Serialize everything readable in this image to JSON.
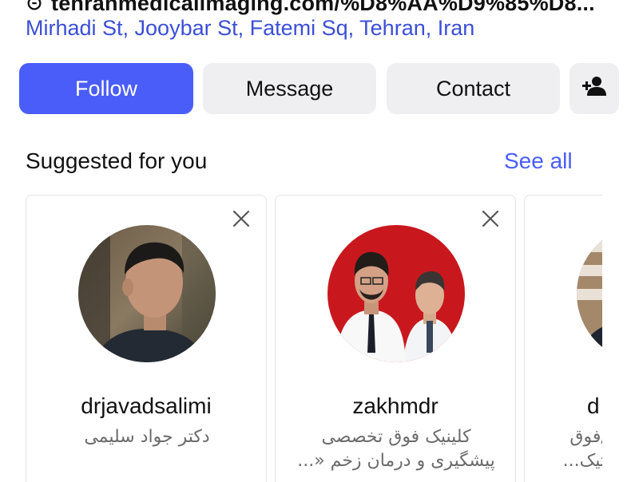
{
  "profile": {
    "link_text": "tehranmedicalimaging.com/%D8%AA%D9%85%D8...",
    "link_icon": "link-icon",
    "address": "Mirhadi St, Jooybar St, Fatemi Sq, Tehran, Iran"
  },
  "actions": {
    "follow_label": "Follow",
    "message_label": "Message",
    "contact_label": "Contact",
    "add_user_icon": "add-person-icon"
  },
  "suggested": {
    "title": "Suggested for you",
    "see_all_label": "See all",
    "cards": [
      {
        "username": "drjavadsalimi",
        "bio": "دکتر جواد سلیمی",
        "avatar_icon": "profile-photo"
      },
      {
        "username": "zakhmdr",
        "bio": "کلینیک فوق تخصصی پیشگیری و درمان زخم «...",
        "avatar_icon": "profile-photo"
      },
      {
        "username": "d",
        "bio": "ی/فوق ستیک...",
        "avatar_icon": "profile-photo"
      }
    ]
  },
  "colors": {
    "accent": "#4a5df9",
    "address_link": "#3b4fd6",
    "button_secondary": "#efeff2",
    "card_border": "#e4e4e8",
    "bio_text": "#6b6b6b"
  }
}
